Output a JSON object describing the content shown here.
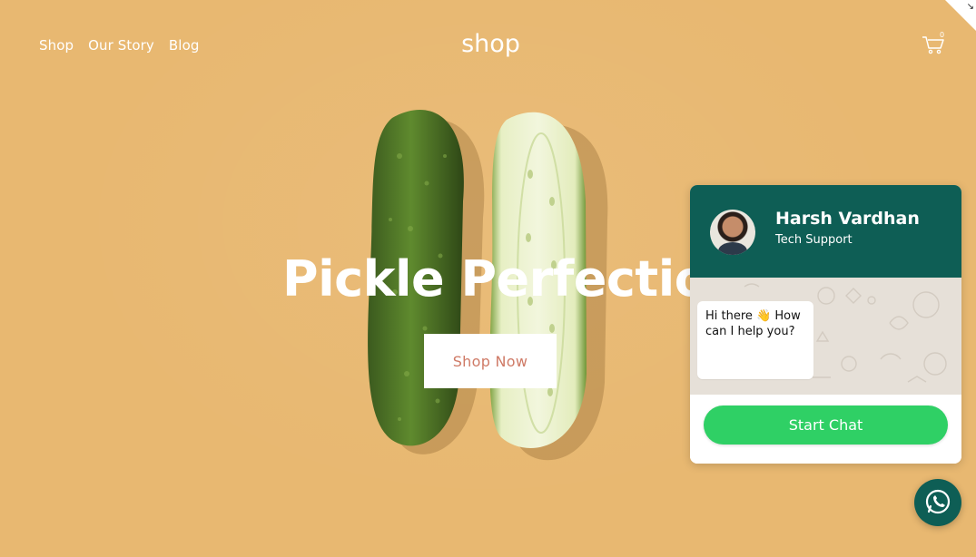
{
  "nav": {
    "items": [
      "Shop",
      "Our Story",
      "Blog"
    ]
  },
  "brand": "shop",
  "cart": {
    "count": "0",
    "icon": "cart-icon"
  },
  "hero": {
    "title": "Pickle Perfection",
    "cta_label": "Shop Now"
  },
  "chat": {
    "agent_name": "Harsh Vardhan",
    "agent_role": "Tech Support",
    "greeting": "Hi there 👋  How can I help you?",
    "start_label": "Start Chat",
    "header_color": "#0e5e55",
    "button_color": "#2fd065"
  },
  "fab": {
    "icon": "whatsapp-icon"
  },
  "colors": {
    "background": "#e8b871",
    "cta_text": "#cf7a66"
  }
}
